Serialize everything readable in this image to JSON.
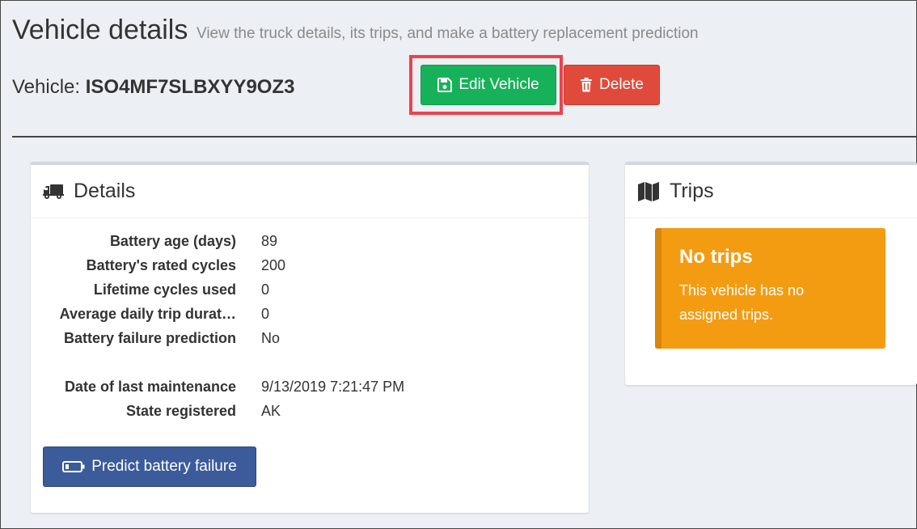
{
  "header": {
    "title": "Vehicle details",
    "subtitle": "View the truck details, its trips, and make a battery replacement prediction"
  },
  "vehicle": {
    "label": "Vehicle:",
    "id": "ISO4MF7SLBXYY9OZ3"
  },
  "actions": {
    "edit_label": "Edit Vehicle",
    "delete_label": "Delete"
  },
  "details": {
    "title": "Details",
    "fields": [
      {
        "key": "Battery age (days)",
        "value": "89"
      },
      {
        "key": "Battery's rated cycles",
        "value": "200"
      },
      {
        "key": "Lifetime cycles used",
        "value": "0"
      },
      {
        "key": "Average daily trip durat…",
        "value": "0"
      },
      {
        "key": "Battery failure prediction",
        "value": "No"
      },
      {
        "key": "Date of last maintenance",
        "value": "9/13/2019 7:21:47 PM"
      },
      {
        "key": "State registered",
        "value": "AK"
      }
    ],
    "predict_label": "Predict battery failure"
  },
  "trips": {
    "title": "Trips",
    "callout_title": "No trips",
    "callout_body": "This vehicle has no assigned trips."
  },
  "colors": {
    "edit": "#17b15a",
    "delete": "#e04a3b",
    "predict": "#3b5b9a",
    "callout": "#f39c12",
    "highlight": "#e8444c"
  },
  "icons": {
    "edit": "floppy-disk-icon",
    "delete": "trash-icon",
    "details": "truck-icon",
    "trips": "map-icon",
    "predict": "battery-icon"
  }
}
